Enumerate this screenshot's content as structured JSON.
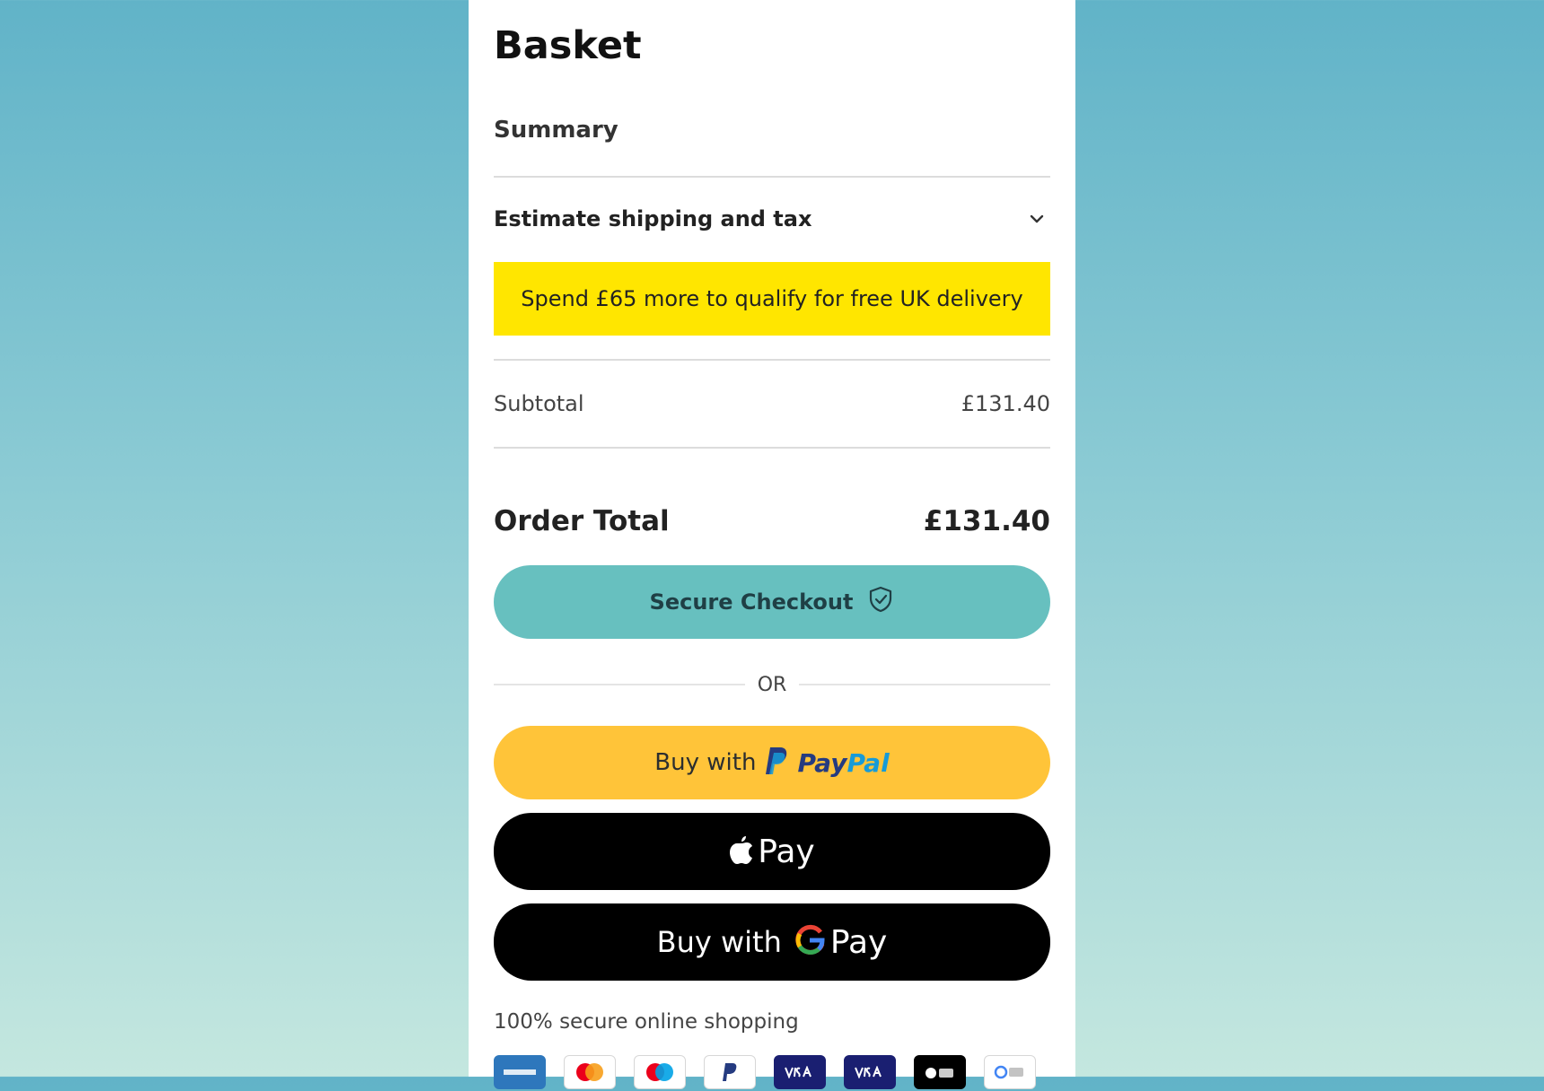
{
  "basket": {
    "title": "Basket",
    "summary_heading": "Summary",
    "estimate_label": "Estimate shipping and tax",
    "promo_text": "Spend £65 more to qualify for free UK delivery",
    "subtotal_label": "Subtotal",
    "subtotal_value": "£131.40",
    "total_label": "Order Total",
    "total_value": "£131.40"
  },
  "actions": {
    "checkout_label": "Secure Checkout",
    "or_label": "OR",
    "paypal_prefix": "Buy with",
    "paypal_word_a": "Pay",
    "paypal_word_b": "Pal",
    "applepay_text": "Pay",
    "gpay_prefix": "Buy with",
    "gpay_text": "Pay"
  },
  "footer": {
    "secure_text": "100% secure online shopping",
    "payment_icons": [
      "amex-icon",
      "mastercard-icon",
      "maestro-icon",
      "paypal-icon",
      "visa-icon",
      "visa-icon",
      "apple-pay-icon",
      "google-pay-icon"
    ]
  },
  "colors": {
    "promo_bg": "#ffe600",
    "checkout_bg": "#67c0bf",
    "paypal_bg": "#ffc439",
    "wallet_bg": "#000000"
  }
}
